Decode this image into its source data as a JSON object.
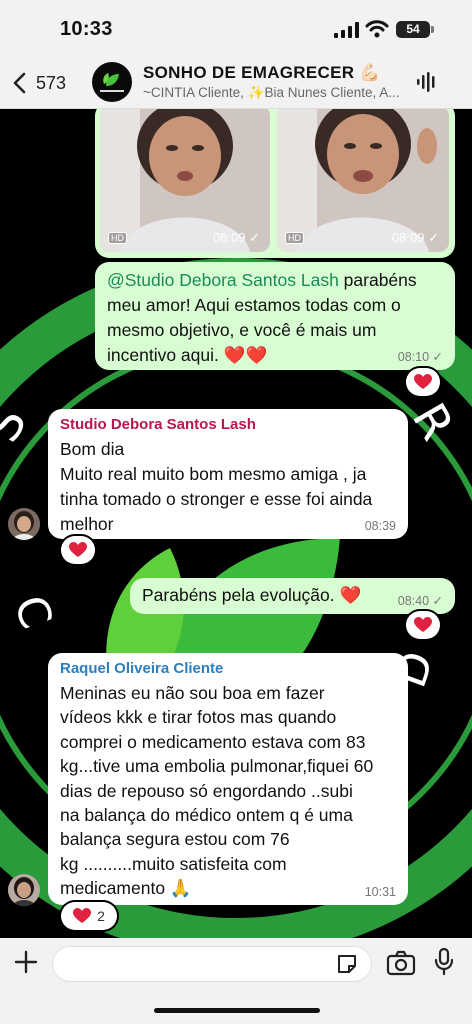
{
  "status": {
    "time": "10:33",
    "battery": "54"
  },
  "header": {
    "back_count": "573",
    "title": "SONHO DE EMAGRECER 💪🏻",
    "subtitle": "~CINTIA Cliente, ✨Bia Nunes Cliente, A..."
  },
  "photos": [
    {
      "time": "08:09 ✓",
      "hd": "HD"
    },
    {
      "time": "08:09 ✓",
      "hd": "HD"
    }
  ],
  "messages": [
    {
      "type": "outgoing",
      "mention": "@Studio Debora Santos Lash",
      "text_line1": " parabéns",
      "lines": [
        "meu amor! Aqui estamos todas com o",
        "mesmo objetivo, e você é mais um",
        "incentivo aqui. ❤️❤️"
      ],
      "time": "08:10 ✓"
    },
    {
      "type": "incoming",
      "sender": "Studio Debora Santos Lash",
      "sender_color": "#b8184a",
      "lines": [
        "Bom dia",
        "Muito real muito bom mesmo amiga , ja",
        "tinha tomado o stronger e esse foi ainda",
        "melhor"
      ],
      "time": "08:39"
    },
    {
      "type": "outgoing",
      "lines": [
        "Parabéns pela evolução. ❤️"
      ],
      "time": "08:40 ✓"
    },
    {
      "type": "incoming",
      "sender": "Raquel Oliveira Cliente",
      "sender_color": "#2b7fbf",
      "lines": [
        "Meninas eu não sou boa em fazer",
        "vídeos kkk e tirar fotos mas quando",
        "comprei o medicamento estava com 83",
        "kg...tive uma embolia pulmonar,fiquei 60",
        "dias de repouso só engordando ..subi",
        "na balança do médico ontem q é uma",
        "balança segura estou com 76",
        "kg ..........muito satisfeita com",
        "medicamento 🙏"
      ],
      "time": "10:31",
      "reaction_count": "2"
    }
  ],
  "colors": {
    "outgoing": "#d9fdd2",
    "incoming": "#ffffff",
    "heart": "#e0213f",
    "accent": "#2fb34a"
  }
}
